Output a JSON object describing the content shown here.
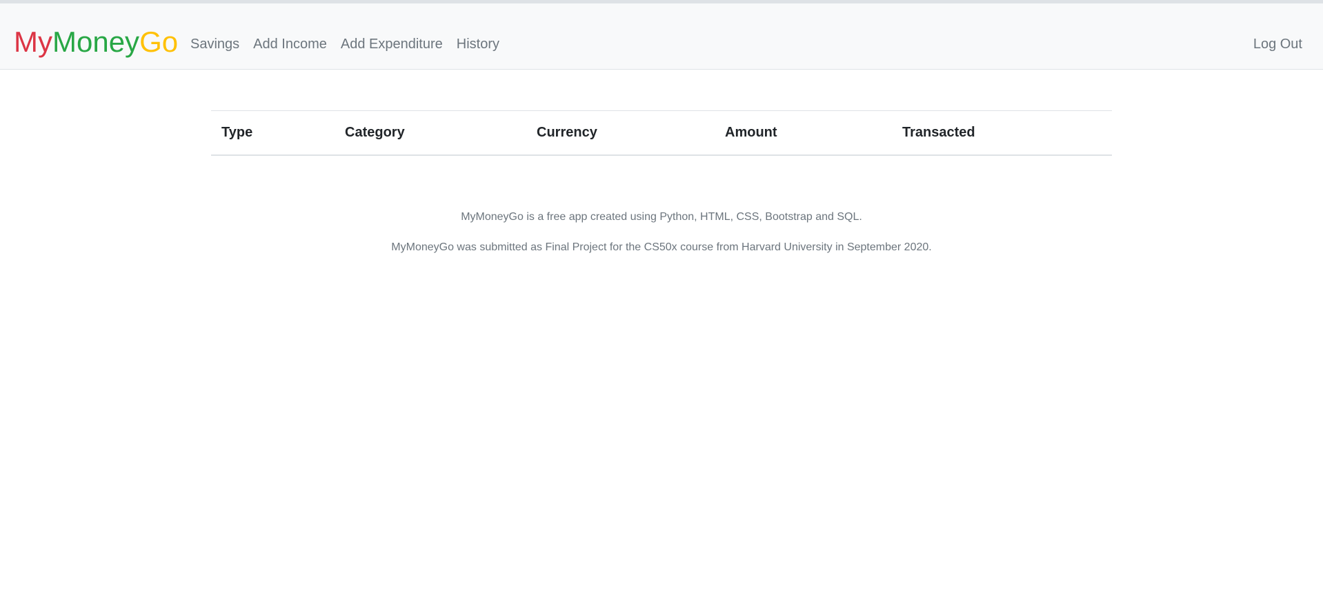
{
  "brand": {
    "part1": "My",
    "part2": "Money",
    "part3": "Go"
  },
  "nav": {
    "items": [
      {
        "label": "Savings"
      },
      {
        "label": "Add Income"
      },
      {
        "label": "Add Expenditure"
      },
      {
        "label": "History"
      }
    ],
    "logout_label": "Log Out"
  },
  "table": {
    "headers": [
      "Type",
      "Category",
      "Currency",
      "Amount",
      "Transacted"
    ],
    "rows": []
  },
  "footer": {
    "line1": "MyMoneyGo is a free app created using Python, HTML, CSS, Bootstrap and SQL.",
    "line2": "MyMoneyGo was submitted as Final Project for the CS50x course from Harvard University in September 2020."
  },
  "colors": {
    "brand_red": "#dc3545",
    "brand_green": "#28a745",
    "brand_yellow": "#ffc107",
    "nav_text": "#6c757d"
  }
}
